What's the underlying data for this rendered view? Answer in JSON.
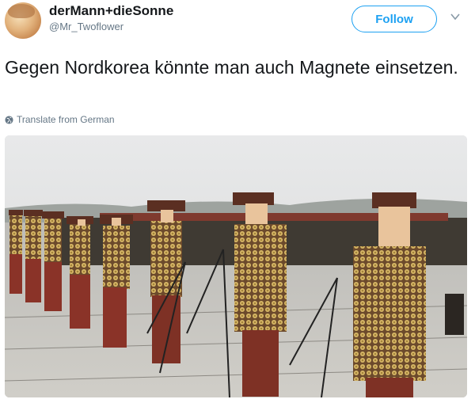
{
  "tweet": {
    "display_name": "derMann+dieSonne",
    "handle": "@Mr_Twoflower",
    "follow_label": "Follow",
    "text": "Gegen Nordkorea könnte man auch Magnete einsetzen.",
    "translate_label": "Translate from German"
  },
  "colors": {
    "accent": "#1da1f2",
    "secondary_text": "#657786",
    "primary_text": "#14171a"
  },
  "icons": {
    "more_menu": "chevron-down-icon",
    "translate": "globe-icon"
  }
}
